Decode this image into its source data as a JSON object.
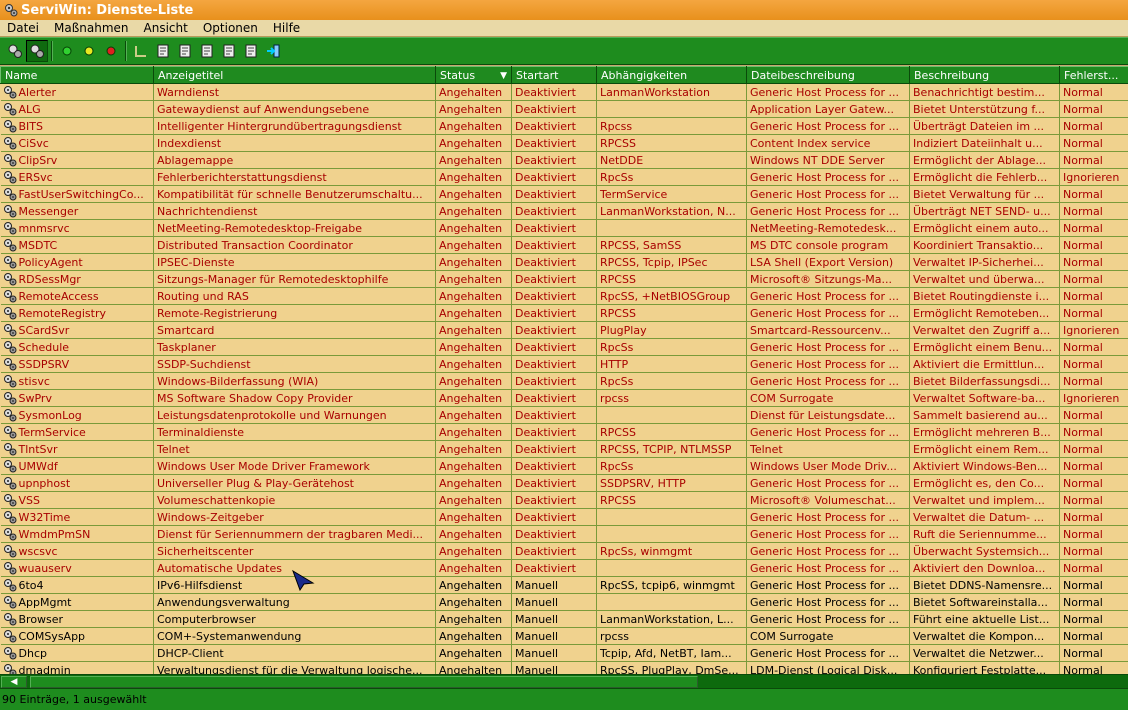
{
  "window": {
    "title": "ServiWin: Dienste-Liste"
  },
  "menu": [
    "Datei",
    "Maßnahmen",
    "Ansicht",
    "Optionen",
    "Hilfe"
  ],
  "toolbar": [
    {
      "icon": "services-icon"
    },
    {
      "icon": "drivers-icon",
      "pressed": true
    },
    {
      "sep": true
    },
    {
      "icon": "start-icon",
      "color": "#30d030"
    },
    {
      "icon": "pause-icon",
      "color": "#e8e820"
    },
    {
      "icon": "stop-icon",
      "color": "#e02020"
    },
    {
      "sep": true
    },
    {
      "icon": "startup-type-icon"
    },
    {
      "icon": "properties-icon"
    },
    {
      "icon": "copy-icon"
    },
    {
      "icon": "save-icon"
    },
    {
      "icon": "report-icon"
    },
    {
      "icon": "find-icon"
    },
    {
      "icon": "exit-icon"
    }
  ],
  "columns": [
    "Name",
    "Anzeigetitel",
    "Status",
    "Startart",
    "Abhängigkeiten",
    "Dateibeschreibung",
    "Beschreibung",
    "Fehlerst..."
  ],
  "rows": [
    {
      "c": [
        "Alerter",
        "Warndienst",
        "Angehalten",
        "Deaktiviert",
        "LanmanWorkstation",
        "Generic Host Process for ...",
        "Benachrichtigt bestim...",
        "Normal"
      ],
      "red": true
    },
    {
      "c": [
        "ALG",
        "Gatewaydienst auf Anwendungsebene",
        "Angehalten",
        "Deaktiviert",
        "",
        "Application Layer Gatew...",
        "Bietet Unterstützung f...",
        "Normal"
      ],
      "red": true
    },
    {
      "c": [
        "BITS",
        "Intelligenter Hintergrundübertragungsdienst",
        "Angehalten",
        "Deaktiviert",
        "Rpcss",
        "Generic Host Process for ...",
        "Überträgt Dateien im ...",
        "Normal"
      ],
      "red": true
    },
    {
      "c": [
        "CiSvc",
        "Indexdienst",
        "Angehalten",
        "Deaktiviert",
        "RPCSS",
        "Content Index service",
        "Indiziert Dateiinhalt u...",
        "Normal"
      ],
      "red": true
    },
    {
      "c": [
        "ClipSrv",
        "Ablagemappe",
        "Angehalten",
        "Deaktiviert",
        "NetDDE",
        "Windows NT DDE Server",
        "Ermöglicht der Ablage...",
        "Normal"
      ],
      "red": true
    },
    {
      "c": [
        "ERSvc",
        "Fehlerberichterstattungsdienst",
        "Angehalten",
        "Deaktiviert",
        "RpcSs",
        "Generic Host Process for ...",
        "Ermöglicht die Fehlerb...",
        "Ignorieren"
      ],
      "red": true
    },
    {
      "c": [
        "FastUserSwitchingCo...",
        "Kompatibilität für schnelle Benutzerumschaltu...",
        "Angehalten",
        "Deaktiviert",
        "TermService",
        "Generic Host Process for ...",
        "Bietet Verwaltung für ...",
        "Normal"
      ],
      "red": true
    },
    {
      "c": [
        "Messenger",
        "Nachrichtendienst",
        "Angehalten",
        "Deaktiviert",
        "LanmanWorkstation, N...",
        "Generic Host Process for ...",
        "Überträgt NET SEND- u...",
        "Normal"
      ],
      "red": true
    },
    {
      "c": [
        "mnmsrvc",
        "NetMeeting-Remotedesktop-Freigabe",
        "Angehalten",
        "Deaktiviert",
        "",
        "NetMeeting-Remotedesk...",
        "Ermöglicht einem auto...",
        "Normal"
      ],
      "red": true
    },
    {
      "c": [
        "MSDTC",
        "Distributed Transaction Coordinator",
        "Angehalten",
        "Deaktiviert",
        "RPCSS, SamSS",
        "MS DTC console program",
        "Koordiniert Transaktio...",
        "Normal"
      ],
      "red": true
    },
    {
      "c": [
        "PolicyAgent",
        "IPSEC-Dienste",
        "Angehalten",
        "Deaktiviert",
        "RPCSS, Tcpip, IPSec",
        "LSA Shell (Export Version)",
        "Verwaltet IP-Sicherhei...",
        "Normal"
      ],
      "red": true
    },
    {
      "c": [
        "RDSessMgr",
        "Sitzungs-Manager für Remotedesktophilfe",
        "Angehalten",
        "Deaktiviert",
        "RPCSS",
        "Microsoft® Sitzungs-Ma...",
        "Verwaltet und überwa...",
        "Normal"
      ],
      "red": true
    },
    {
      "c": [
        "RemoteAccess",
        "Routing und RAS",
        "Angehalten",
        "Deaktiviert",
        "RpcSS, +NetBIOSGroup",
        "Generic Host Process for ...",
        "Bietet Routingdienste i...",
        "Normal"
      ],
      "red": true
    },
    {
      "c": [
        "RemoteRegistry",
        "Remote-Registrierung",
        "Angehalten",
        "Deaktiviert",
        "RPCSS",
        "Generic Host Process for ...",
        "Ermöglicht Remoteben...",
        "Normal"
      ],
      "red": true
    },
    {
      "c": [
        "SCardSvr",
        "Smartcard",
        "Angehalten",
        "Deaktiviert",
        "PlugPlay",
        "Smartcard-Ressourcenv...",
        "Verwaltet den Zugriff a...",
        "Ignorieren"
      ],
      "red": true
    },
    {
      "c": [
        "Schedule",
        "Taskplaner",
        "Angehalten",
        "Deaktiviert",
        "RpcSs",
        "Generic Host Process for ...",
        "Ermöglicht einem Benu...",
        "Normal"
      ],
      "red": true
    },
    {
      "c": [
        "SSDPSRV",
        "SSDP-Suchdienst",
        "Angehalten",
        "Deaktiviert",
        "HTTP",
        "Generic Host Process for ...",
        "Aktiviert die Ermittlun...",
        "Normal"
      ],
      "red": true
    },
    {
      "c": [
        "stisvc",
        "Windows-Bilderfassung (WIA)",
        "Angehalten",
        "Deaktiviert",
        "RpcSs",
        "Generic Host Process for ...",
        "Bietet Bilderfassungsdi...",
        "Normal"
      ],
      "red": true
    },
    {
      "c": [
        "SwPrv",
        "MS Software Shadow Copy Provider",
        "Angehalten",
        "Deaktiviert",
        "rpcss",
        "COM Surrogate",
        "Verwaltet Software-ba...",
        "Ignorieren"
      ],
      "red": true
    },
    {
      "c": [
        "SysmonLog",
        "Leistungsdatenprotokolle und Warnungen",
        "Angehalten",
        "Deaktiviert",
        "",
        "Dienst für Leistungsdate...",
        "Sammelt basierend au...",
        "Normal"
      ],
      "red": true
    },
    {
      "c": [
        "TermService",
        "Terminaldienste",
        "Angehalten",
        "Deaktiviert",
        "RPCSS",
        "Generic Host Process for ...",
        "Ermöglicht mehreren B...",
        "Normal"
      ],
      "red": true
    },
    {
      "c": [
        "TlntSvr",
        "Telnet",
        "Angehalten",
        "Deaktiviert",
        "RPCSS, TCPIP, NTLMSSP",
        "Telnet",
        "Ermöglicht einem Rem...",
        "Normal"
      ],
      "red": true
    },
    {
      "c": [
        "UMWdf",
        "Windows User Mode Driver Framework",
        "Angehalten",
        "Deaktiviert",
        "RpcSs",
        "Windows User Mode Driv...",
        "Aktiviert Windows-Ben...",
        "Normal"
      ],
      "red": true
    },
    {
      "c": [
        "upnphost",
        "Universeller Plug & Play-Gerätehost",
        "Angehalten",
        "Deaktiviert",
        "SSDPSRV, HTTP",
        "Generic Host Process for ...",
        "Ermöglicht es, den Co...",
        "Normal"
      ],
      "red": true
    },
    {
      "c": [
        "VSS",
        "Volumeschattenkopie",
        "Angehalten",
        "Deaktiviert",
        "RPCSS",
        "Microsoft® Volumeschat...",
        "Verwaltet und implem...",
        "Normal"
      ],
      "red": true
    },
    {
      "c": [
        "W32Time",
        "Windows-Zeitgeber",
        "Angehalten",
        "Deaktiviert",
        "",
        "Generic Host Process for ...",
        "Verwaltet die Datum- ...",
        "Normal"
      ],
      "red": true
    },
    {
      "c": [
        "WmdmPmSN",
        "Dienst für Seriennummern der tragbaren Medi...",
        "Angehalten",
        "Deaktiviert",
        "",
        "Generic Host Process for ...",
        "Ruft die Seriennumme...",
        "Normal"
      ],
      "red": true
    },
    {
      "c": [
        "wscsvc",
        "Sicherheitscenter",
        "Angehalten",
        "Deaktiviert",
        "RpcSs, winmgmt",
        "Generic Host Process for ...",
        "Überwacht Systemsich...",
        "Normal"
      ],
      "red": true
    },
    {
      "c": [
        "wuauserv",
        "Automatische Updates",
        "Angehalten",
        "Deaktiviert",
        "",
        "Generic Host Process for ...",
        "Aktiviert den Downloa...",
        "Normal"
      ],
      "red": true
    },
    {
      "c": [
        "6to4",
        "IPv6-Hilfsdienst",
        "Angehalten",
        "Manuell",
        "RpcSS, tcpip6, winmgmt",
        "Generic Host Process for ...",
        "Bietet DDNS-Namensre...",
        "Normal"
      ],
      "red": false
    },
    {
      "c": [
        "AppMgmt",
        "Anwendungsverwaltung",
        "Angehalten",
        "Manuell",
        "",
        "Generic Host Process for ...",
        "Bietet Softwareinstalla...",
        "Normal"
      ],
      "red": false
    },
    {
      "c": [
        "Browser",
        "Computerbrowser",
        "Angehalten",
        "Manuell",
        "LanmanWorkstation, L...",
        "Generic Host Process for ...",
        "Führt eine aktuelle List...",
        "Normal"
      ],
      "red": false
    },
    {
      "c": [
        "COMSysApp",
        "COM+-Systemanwendung",
        "Angehalten",
        "Manuell",
        "rpcss",
        "COM Surrogate",
        "Verwaltet die Kompon...",
        "Normal"
      ],
      "red": false
    },
    {
      "c": [
        "Dhcp",
        "DHCP-Client",
        "Angehalten",
        "Manuell",
        "Tcpip, Afd, NetBT, Iam...",
        "Generic Host Process for ...",
        "Verwaltet die Netzwer...",
        "Normal"
      ],
      "red": false
    },
    {
      "c": [
        "dmadmin",
        "Verwaltungsdienst für die Verwaltung logische...",
        "Angehalten",
        "Manuell",
        "RpcSS, PlugPlay, DmSe...",
        "LDM-Dienst (Logical Disk...",
        "Konfiguriert Festplatte...",
        "Normal"
      ],
      "red": false
    }
  ],
  "status": {
    "text": "90 Einträge, 1 ausgewählt"
  }
}
